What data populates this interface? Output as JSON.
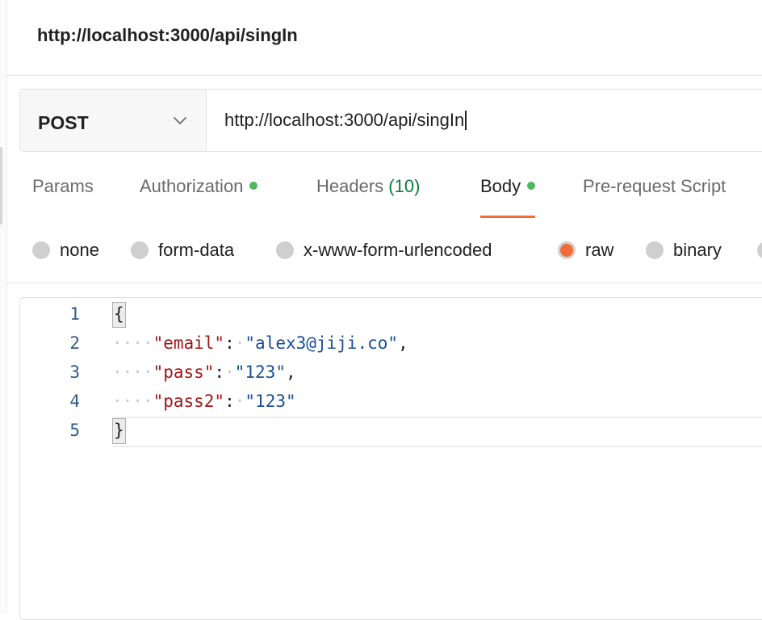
{
  "request": {
    "title": "http://localhost:3000/api/singIn",
    "method": "POST",
    "url": "http://localhost:3000/api/singIn"
  },
  "tabs": [
    {
      "label": "Params"
    },
    {
      "label": "Authorization"
    },
    {
      "label": "Headers",
      "count": "(10)"
    },
    {
      "label": "Body"
    },
    {
      "label": "Pre-request Script"
    }
  ],
  "body_types": [
    {
      "label": "none"
    },
    {
      "label": "form-data"
    },
    {
      "label": "x-www-form-urlencoded"
    },
    {
      "label": "raw",
      "selected": true
    },
    {
      "label": "binary"
    }
  ],
  "editor": {
    "line_numbers": [
      "1",
      "2",
      "3",
      "4",
      "5"
    ],
    "open_brace": "{",
    "close_brace": "}",
    "fields": [
      {
        "key": "\"email\"",
        "value": "\"alex3@jiji.co\"",
        "trail": ","
      },
      {
        "key": "\"pass\"",
        "value": "\"123\"",
        "trail": ","
      },
      {
        "key": "\"pass2\"",
        "value": "\"123\"",
        "trail": ""
      }
    ]
  },
  "colors": {
    "accent": "#f26b3a",
    "status_dot": "#4cb95c",
    "count_green": "#0a7d3c",
    "json_key": "#a31515",
    "json_string": "#1a4d99"
  },
  "icons": {
    "method_dropdown": "chevron-down-icon"
  }
}
